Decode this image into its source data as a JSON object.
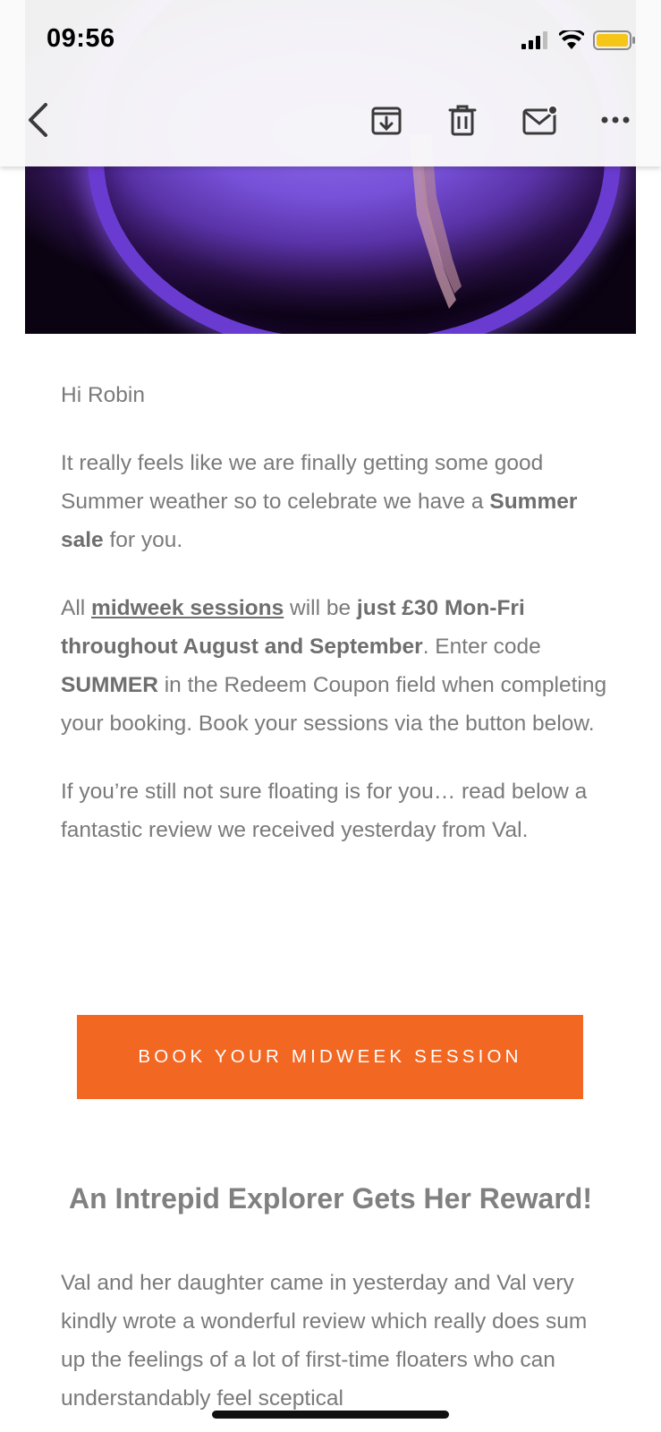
{
  "status_bar": {
    "time": "09:56"
  },
  "toolbar": {
    "back": "back-icon",
    "archive": "archive-icon",
    "delete": "trash-icon",
    "mark_unread": "mail-unread-icon",
    "more": "more-icon"
  },
  "email": {
    "greeting": "Hi Robin",
    "para1": {
      "text_before": "It really feels like we are finally getting some good Summer weather so to celebrate we have a ",
      "bold": "Summer sale",
      "text_after": " for you."
    },
    "para2": {
      "t1": "All ",
      "link": "midweek sessions",
      "t2": " will be ",
      "bold1": "just £30 Mon-Fri throughout August and September",
      "t3": ". Enter code ",
      "bold2": "SUMMER",
      "t4": " in the Redeem Coupon field when completing your booking. Book your sessions via the button below."
    },
    "para3": "If you’re still not sure floating is for you… read below a fantastic review we received yesterday from Val.",
    "cta_label": "BOOK YOUR MIDWEEK SESSION",
    "heading": "An Intrepid Explorer Gets Her Reward!",
    "review_para": "Val and her daughter came in yesterday and Val very kindly wrote a wonderful review which really does sum up the feelings of a lot of first-time floaters who can understandably feel sceptical"
  },
  "colors": {
    "accent": "#f26722",
    "text": "#7a7a7a",
    "battery": "#f5c518"
  }
}
